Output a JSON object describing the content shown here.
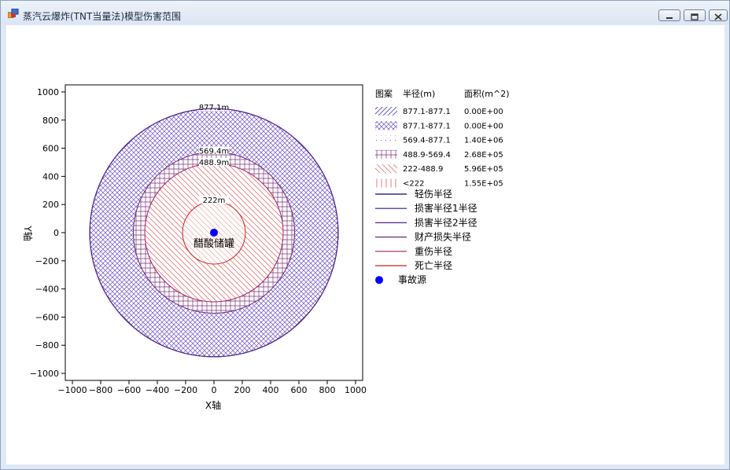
{
  "window": {
    "title": "蒸汽云爆炸(TNT当量法)模型伤害范围",
    "accent": "#dbe5f3"
  },
  "chart_data": {
    "type": "scatter",
    "xlabel": "X轴",
    "ylabel": "Y轴",
    "xlim": [
      -1050,
      1050
    ],
    "ylim": [
      -1050,
      1050
    ],
    "xticks": [
      -1000,
      -800,
      -600,
      -400,
      -200,
      0,
      200,
      400,
      600,
      800,
      1000
    ],
    "yticks": [
      1000,
      800,
      600,
      400,
      200,
      0,
      -200,
      -400,
      -600,
      -800,
      -1000
    ],
    "grid": false,
    "legend_position": "right",
    "source": {
      "name": "事故源",
      "x": 0,
      "y": 0,
      "label": "醋酸储罐",
      "color": "#0000ff"
    },
    "circles": [
      {
        "name": "轻伤半径",
        "radius": 877.1,
        "label": "877.1m",
        "color": "#000080"
      },
      {
        "name": "损害半径1半径",
        "radius": 877.1,
        "label": "",
        "color": "#2b1a8a"
      },
      {
        "name": "损害半径2半径",
        "radius": 877.1,
        "label": "",
        "color": "#55228a"
      },
      {
        "name": "财产损失半径",
        "radius": 569.4,
        "label": "569.4m",
        "color": "#6a2a7a"
      },
      {
        "name": "重伤半径",
        "radius": 488.9,
        "label": "488.9m",
        "color": "#a0205a"
      },
      {
        "name": "死亡半径",
        "radius": 222,
        "label": "222m",
        "color": "#cc1f1f"
      }
    ],
    "bands": [
      {
        "range": "877.1-877.1",
        "area": "0.00E+00",
        "pattern": "diag-blue"
      },
      {
        "range": "877.1-877.1",
        "area": "0.00E+00",
        "pattern": "cross-purple"
      },
      {
        "range": "569.4-877.1",
        "area": "1.40E+06",
        "pattern": "dots-red"
      },
      {
        "range": "488.9-569.4",
        "area": "2.68E+05",
        "pattern": "grid-purple"
      },
      {
        "range": "222-488.9",
        "area": "5.96E+05",
        "pattern": "diag-red"
      },
      {
        "range": "<222",
        "area": "1.55E+05",
        "pattern": "vert-red"
      }
    ],
    "legend_headers": {
      "pattern": "图案",
      "radius": "半径(m)",
      "area": "面积(m^2)"
    }
  }
}
